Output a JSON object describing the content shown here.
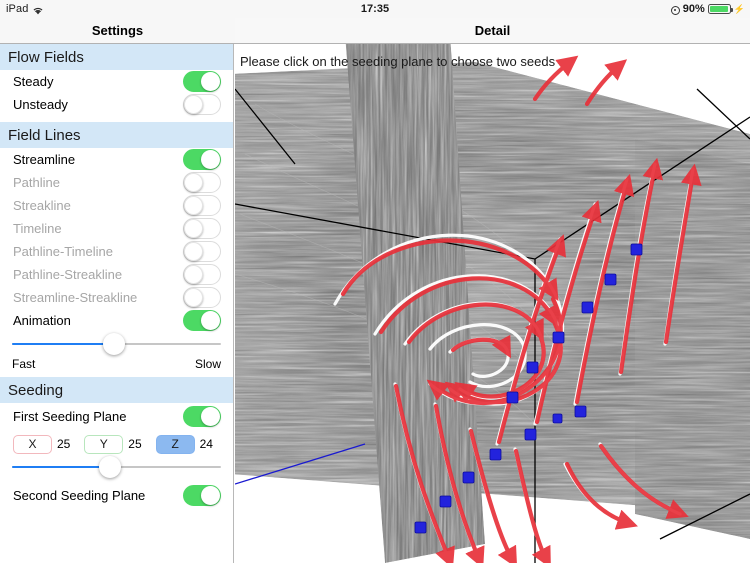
{
  "statusbar": {
    "carrier": "iPad",
    "wifi_icon": "wifi-icon",
    "time": "17:35",
    "orientation_lock_icon": "rotation-lock-icon",
    "battery_percent": "90%",
    "battery_icon": "battery-icon",
    "charging_icon": "lightning-bolt-icon"
  },
  "sidebar": {
    "title": "Settings",
    "sections": [
      {
        "header": "Flow Fields",
        "rows": [
          {
            "label": "Steady",
            "state": "on",
            "enabled": true
          },
          {
            "label": "Unsteady",
            "state": "off",
            "enabled": true
          }
        ]
      },
      {
        "header": "Field Lines",
        "rows": [
          {
            "label": "Streamline",
            "state": "on",
            "enabled": true
          },
          {
            "label": "Pathline",
            "state": "off",
            "enabled": false
          },
          {
            "label": "Streakline",
            "state": "off",
            "enabled": false
          },
          {
            "label": "Timeline",
            "state": "off",
            "enabled": false
          },
          {
            "label": "Pathline-Timeline",
            "state": "off",
            "enabled": false
          },
          {
            "label": "Pathline-Streakline",
            "state": "off",
            "enabled": false
          },
          {
            "label": "Streamline-Streakline",
            "state": "off",
            "enabled": false
          },
          {
            "label": "Animation",
            "state": "on",
            "enabled": true
          }
        ],
        "slider": {
          "value_percent": 49,
          "label_left": "Fast",
          "label_right": "Slow"
        }
      },
      {
        "header": "Seeding",
        "first_plane": {
          "label": "First Seeding Plane",
          "state": "on"
        },
        "axes": [
          {
            "axis": "X",
            "value": "25",
            "selected": false
          },
          {
            "axis": "Y",
            "value": "25",
            "selected": false
          },
          {
            "axis": "Z",
            "value": "24",
            "selected": true
          }
        ],
        "plane_slider": {
          "value_percent": 47
        },
        "second_plane": {
          "label": "Second Seeding Plane",
          "state": "on"
        }
      }
    ]
  },
  "detail": {
    "title": "Detail",
    "instruction": "Please click on the seeding plane to choose two seeds",
    "visualization": {
      "type": "3d-flow-field",
      "plane_texture": "line-integral-convolution-grayscale",
      "streamline_color": "#ffffff",
      "arrow_glyph_color": "#e8313a",
      "seed_marker_color": "#2323dd",
      "axis_line_color": "#000000",
      "axis_secondary_color": "#1a1ad0"
    }
  }
}
